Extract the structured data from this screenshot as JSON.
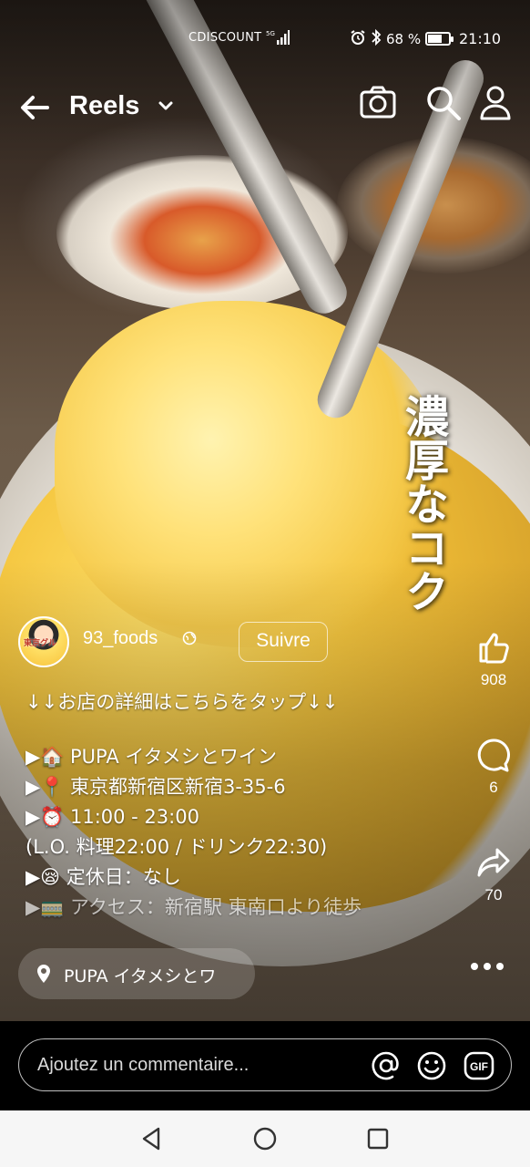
{
  "status_bar": {
    "carrier": "CDISCOUNT",
    "network": "5G",
    "battery": "68 %",
    "battery_level": 0.68,
    "time": "21:10",
    "alarm_icon": "alarm-icon",
    "bluetooth_icon": "bluetooth-icon"
  },
  "header": {
    "title": "Reels",
    "back_icon": "arrow-left-icon",
    "dropdown_icon": "chevron-down-icon",
    "camera_icon": "camera-icon",
    "search_icon": "search-icon",
    "profile_icon": "profile-icon"
  },
  "video": {
    "caption": "濃厚なコク"
  },
  "author": {
    "username": "93_foods",
    "avatar_badge": "東京グル",
    "follow_label": "Suivre"
  },
  "description": {
    "lines": [
      "↓↓お店の詳細はこちらをタップ↓↓",
      "",
      "▶🏠 PUPA イタメシとワイン",
      "▶📍 東京都新宿区新宿3-35-6",
      "▶⏰ 11:00 - 23:00",
      "   (L.O. 料理22:00 / ドリンク22:30)",
      "▶😪 定休日：なし",
      "▶🚃 アクセス：新宿駅 東南口より徒歩"
    ]
  },
  "actions": {
    "likes": "908",
    "comments": "6",
    "shares": "70",
    "like_icon": "thumbs-up-icon",
    "comment_icon": "comment-icon",
    "share_icon": "share-icon",
    "more_icon": "more-icon"
  },
  "location": {
    "label": "PUPA イタメシとワ"
  },
  "comment_bar": {
    "placeholder": "Ajoutez un commentaire...",
    "gif_label": "GIF"
  },
  "colors": {
    "overlay_text": "#ffffff",
    "comment_bg": "#000000",
    "nav_bg": "#f6f6f6"
  }
}
